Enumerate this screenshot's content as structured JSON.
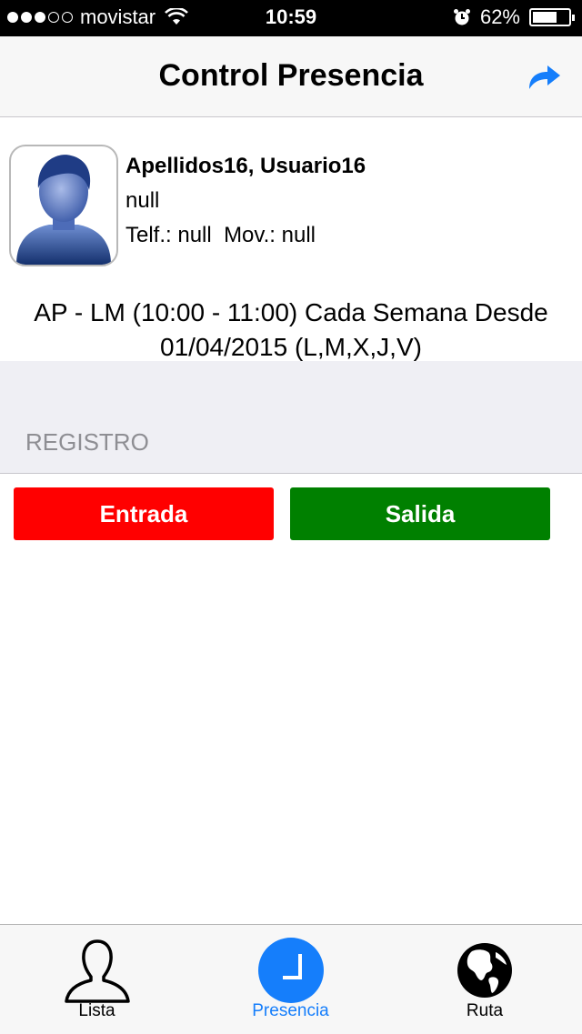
{
  "status_bar": {
    "carrier": "movistar",
    "signal_bars_filled": 3,
    "signal_bars_total": 5,
    "time": "10:59",
    "battery": "62%"
  },
  "nav": {
    "title": "Control Presencia",
    "share_icon": "share-arrow-icon"
  },
  "profile": {
    "name": "Apellidos16, Usuario16",
    "line2": "null",
    "phone_label": "Telf.:",
    "phone_value": "null",
    "mobile_label": "Mov.:",
    "mobile_value": "null",
    "schedule_line1": "AP - LM (10:00 - 11:00) Cada Semana Desde",
    "schedule_line2": "01/04/2015 (L,M,X,J,V)"
  },
  "section": {
    "header": "REGISTRO"
  },
  "buttons": {
    "entrada": "Entrada",
    "salida": "Salida"
  },
  "tabs": [
    {
      "label": "Lista",
      "icon": "person-icon",
      "active": false
    },
    {
      "label": "Presencia",
      "icon": "clock-icon",
      "active": true
    },
    {
      "label": "Ruta",
      "icon": "globe-icon",
      "active": false
    }
  ],
  "colors": {
    "accent": "#157efb",
    "entrada": "#ff0000",
    "salida": "#008000"
  }
}
